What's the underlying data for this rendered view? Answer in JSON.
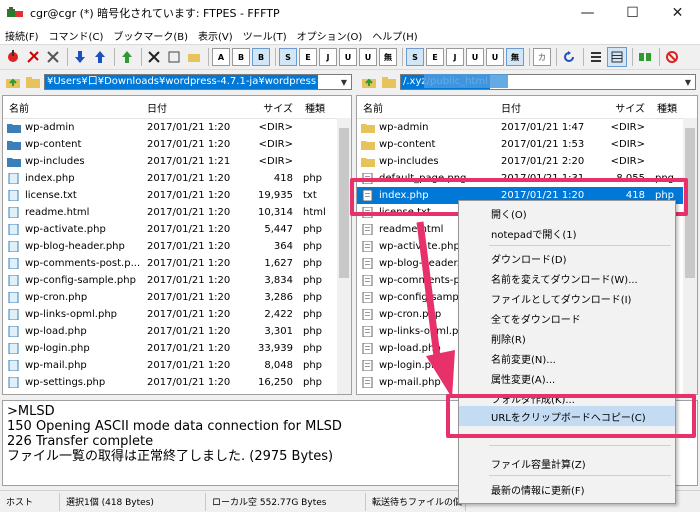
{
  "window": {
    "title": "cgr@cgr (*) 暗号化されています: FTPES - FFFTP",
    "buttons": {
      "minimize": "—",
      "maximize": "☐",
      "close": "✕"
    }
  },
  "menu": [
    "接続(F)",
    "コマンド(C)",
    "ブックマーク(B)",
    "表示(V)",
    "ツール(T)",
    "オプション(O)",
    "ヘルプ(H)"
  ],
  "toolbar": {
    "mode_buttons": [
      "A",
      "B",
      "B"
    ],
    "kanji_buttons": [
      "S",
      "E",
      "J",
      "U",
      "U",
      "無"
    ],
    "kana_label": "カ"
  },
  "left_path": "¥Users¥口¥Downloads¥wordpress-4.7.1-ja¥wordpress",
  "right_path": "/.xyz/public_html",
  "columns": {
    "name": "名前",
    "date": "日付",
    "size": "サイズ",
    "type": "種類"
  },
  "local_files": [
    {
      "name": "wp-admin",
      "date": "2017/01/21  1:20",
      "size": "<DIR>",
      "type": "",
      "kind": "folder"
    },
    {
      "name": "wp-content",
      "date": "2017/01/21  1:20",
      "size": "<DIR>",
      "type": "",
      "kind": "folder"
    },
    {
      "name": "wp-includes",
      "date": "2017/01/21  1:21",
      "size": "<DIR>",
      "type": "",
      "kind": "folder"
    },
    {
      "name": "index.php",
      "date": "2017/01/21  1:20",
      "size": "418",
      "type": "php",
      "kind": "file"
    },
    {
      "name": "license.txt",
      "date": "2017/01/21  1:20",
      "size": "19,935",
      "type": "txt",
      "kind": "file"
    },
    {
      "name": "readme.html",
      "date": "2017/01/21  1:20",
      "size": "10,314",
      "type": "html",
      "kind": "file"
    },
    {
      "name": "wp-activate.php",
      "date": "2017/01/21  1:20",
      "size": "5,447",
      "type": "php",
      "kind": "file"
    },
    {
      "name": "wp-blog-header.php",
      "date": "2017/01/21  1:20",
      "size": "364",
      "type": "php",
      "kind": "file"
    },
    {
      "name": "wp-comments-post.p...",
      "date": "2017/01/21  1:20",
      "size": "1,627",
      "type": "php",
      "kind": "file"
    },
    {
      "name": "wp-config-sample.php",
      "date": "2017/01/21  1:20",
      "size": "3,834",
      "type": "php",
      "kind": "file"
    },
    {
      "name": "wp-cron.php",
      "date": "2017/01/21  1:20",
      "size": "3,286",
      "type": "php",
      "kind": "file"
    },
    {
      "name": "wp-links-opml.php",
      "date": "2017/01/21  1:20",
      "size": "2,422",
      "type": "php",
      "kind": "file"
    },
    {
      "name": "wp-load.php",
      "date": "2017/01/21  1:20",
      "size": "3,301",
      "type": "php",
      "kind": "file"
    },
    {
      "name": "wp-login.php",
      "date": "2017/01/21  1:20",
      "size": "33,939",
      "type": "php",
      "kind": "file"
    },
    {
      "name": "wp-mail.php",
      "date": "2017/01/21  1:20",
      "size": "8,048",
      "type": "php",
      "kind": "file"
    },
    {
      "name": "wp-settings.php",
      "date": "2017/01/21  1:20",
      "size": "16,250",
      "type": "php",
      "kind": "file"
    }
  ],
  "remote_files": [
    {
      "name": "wp-admin",
      "date": "2017/01/21  1:47",
      "size": "<DIR>",
      "type": "",
      "kind": "folder",
      "selected": false
    },
    {
      "name": "wp-content",
      "date": "2017/01/21  1:53",
      "size": "<DIR>",
      "type": "",
      "kind": "folder",
      "selected": false
    },
    {
      "name": "wp-includes",
      "date": "2017/01/21  2:20",
      "size": "<DIR>",
      "type": "",
      "kind": "folder",
      "selected": false
    },
    {
      "name": "default_page.png",
      "date": "2017/01/21  1:31",
      "size": "8,055",
      "type": "png",
      "kind": "file",
      "selected": false
    },
    {
      "name": "index.php",
      "date": "2017/01/21  1:20",
      "size": "418",
      "type": "php",
      "kind": "file",
      "selected": true
    },
    {
      "name": "license.txt",
      "date": "",
      "size": "",
      "type": "",
      "kind": "file",
      "selected": false
    },
    {
      "name": "readme.html",
      "date": "",
      "size": "",
      "type": "",
      "kind": "file",
      "selected": false
    },
    {
      "name": "wp-activate.php",
      "date": "",
      "size": "",
      "type": "",
      "kind": "file",
      "selected": false
    },
    {
      "name": "wp-blog-header.p",
      "date": "",
      "size": "",
      "type": "",
      "kind": "file",
      "selected": false
    },
    {
      "name": "wp-comments-po",
      "date": "",
      "size": "",
      "type": "",
      "kind": "file",
      "selected": false
    },
    {
      "name": "wp-config-sampl",
      "date": "",
      "size": "",
      "type": "",
      "kind": "file",
      "selected": false
    },
    {
      "name": "wp-cron.php",
      "date": "",
      "size": "",
      "type": "",
      "kind": "file",
      "selected": false
    },
    {
      "name": "wp-links-opml.p",
      "date": "",
      "size": "",
      "type": "",
      "kind": "file",
      "selected": false
    },
    {
      "name": "wp-load.php",
      "date": "",
      "size": "",
      "type": "",
      "kind": "file",
      "selected": false
    },
    {
      "name": "wp-login.php",
      "date": "",
      "size": "",
      "type": "",
      "kind": "file",
      "selected": false
    },
    {
      "name": "wp-mail.php",
      "date": "",
      "size": "",
      "type": "",
      "kind": "file",
      "selected": false
    }
  ],
  "context_menu": [
    {
      "label": "開く(O)",
      "highlight": false
    },
    {
      "label": "notepadで開く(1)",
      "highlight": false
    },
    {
      "label": "ダウンロード(D)",
      "highlight": false
    },
    {
      "label": "名前を変えてダウンロード(W)...",
      "highlight": false
    },
    {
      "label": "ファイルとしてダウンロード(I)",
      "highlight": false
    },
    {
      "label": "全てをダウンロード",
      "highlight": false
    },
    {
      "label": "削除(R)",
      "highlight": false
    },
    {
      "label": "名前変更(N)...",
      "highlight": false
    },
    {
      "label": "属性変更(A)...",
      "highlight": false
    },
    {
      "label": "フォルダ作成(K)...",
      "highlight": false
    },
    {
      "label": "URLをクリップボードへコピー(C)",
      "highlight": true
    },
    {
      "label": "ファイル容量計算(Z)",
      "highlight": false
    },
    {
      "label": "最新の情報に更新(F)",
      "highlight": false
    }
  ],
  "log_lines": [
    ">MLSD",
    "150 Opening ASCII mode data connection for MLSD",
    "226 Transfer complete",
    "ファイル一覧の取得は正常終了しました. (2975 Bytes)"
  ],
  "status": {
    "host": "ホスト",
    "selection": "選択1個 (418 Bytes)",
    "local": "ローカル空 552.77G Bytes",
    "queue": "転送待ちファイルの個"
  },
  "colors": {
    "selection": "#0078d7",
    "annotation": "#e8316b",
    "folder": "#e8c25a",
    "menu_highlight": "#c4dcf3"
  }
}
